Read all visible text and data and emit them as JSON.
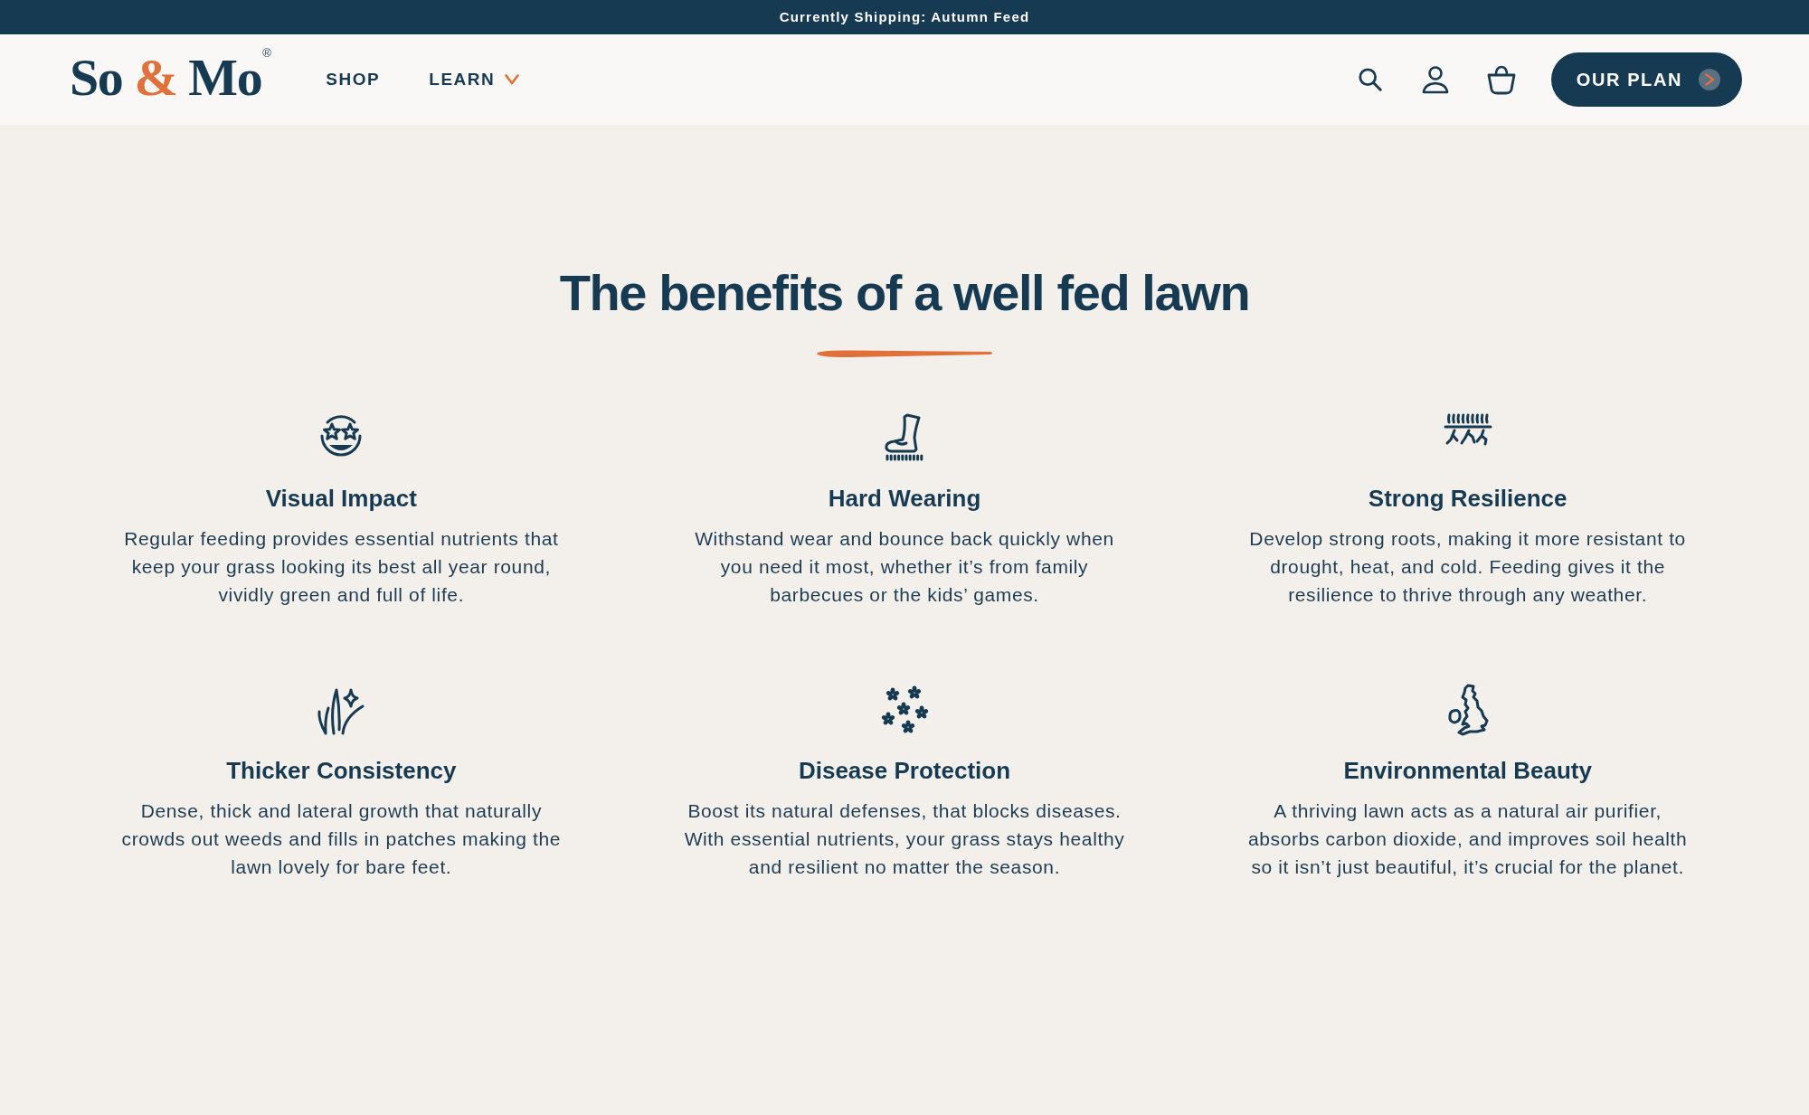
{
  "announcement_bar": {
    "text": "Currently Shipping: Autumn Feed"
  },
  "header": {
    "logo": {
      "before": "So",
      "ampersand": "&",
      "after": "Mo",
      "registered": "®"
    },
    "nav": [
      {
        "label": "SHOP",
        "has_dropdown": false
      },
      {
        "label": "LEARN",
        "has_dropdown": true
      }
    ],
    "cta": {
      "label": "OUR PLAN"
    }
  },
  "benefits_section": {
    "title": "The benefits of a well fed lawn",
    "benefits": [
      {
        "title": "Visual Impact",
        "text": "Regular feeding provides essential nutrients that keep your grass looking its best all year round, vividly green and full of life."
      },
      {
        "title": "Hard Wearing",
        "text": "Withstand wear and bounce back quickly when you need it most, whether it’s from family barbecues or the kids’ games."
      },
      {
        "title": "Strong Resilience",
        "text": "Develop strong roots, making it more resistant to drought, heat, and cold. Feeding gives it the resilience to thrive through any weather."
      },
      {
        "title": "Thicker Consistency",
        "text": "Dense, thick and lateral growth that naturally crowds out weeds and fills in patches making the lawn lovely for bare feet."
      },
      {
        "title": "Disease Protection",
        "text": "Boost its natural defenses, that blocks diseases. With essential nutrients, your grass stays healthy and resilient no matter the season."
      },
      {
        "title": "Environmental Beauty",
        "text": "A thriving lawn acts as a natural air purifier, absorbs carbon dioxide, and improves soil health so it isn’t just beautiful, it’s crucial for the planet."
      }
    ]
  }
}
